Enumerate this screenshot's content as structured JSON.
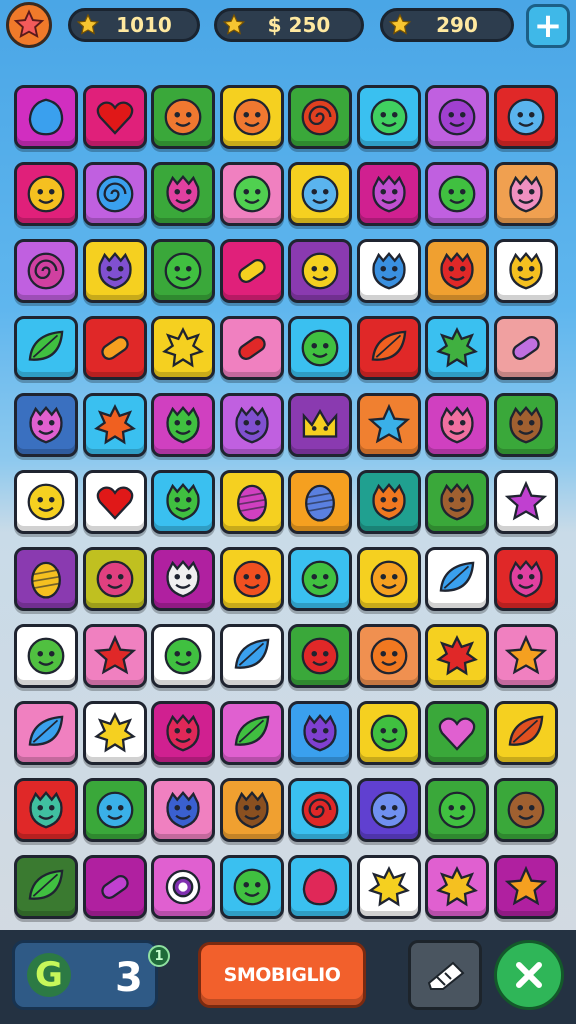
{
  "header": {
    "star_button_icon": "star-icon",
    "counters": [
      {
        "icon": "gold-star-icon",
        "value": "1010"
      },
      {
        "icon": "gold-star-icon",
        "value": "$ 250"
      },
      {
        "icon": "gold-star-icon",
        "value": "290"
      }
    ],
    "add_button_icon": "plus-icon"
  },
  "board": {
    "cols": 8,
    "rows": 12,
    "tiles": [
      [
        {
          "bg": "#d12ec0",
          "icon": "blob",
          "fg": "#3aa0ee"
        },
        {
          "bg": "#e0207a",
          "icon": "heart",
          "fg": "#e01818"
        },
        {
          "bg": "#3aa83a",
          "icon": "face",
          "fg": "#f07830"
        },
        {
          "bg": "#f5d020",
          "icon": "face",
          "fg": "#f07830"
        },
        {
          "bg": "#3aa83a",
          "icon": "swirl",
          "fg": "#e04020"
        },
        {
          "bg": "#3ac0f0",
          "icon": "face",
          "fg": "#40d060"
        },
        {
          "bg": "#c060e0",
          "icon": "face",
          "fg": "#a040d0"
        },
        {
          "bg": "#e02828",
          "icon": "face",
          "fg": "#5ab4ee"
        }
      ],
      [
        {
          "bg": "#e0207a",
          "icon": "face",
          "fg": "#f5c020"
        },
        {
          "bg": "#c060e0",
          "icon": "swirl",
          "fg": "#3aa0ee"
        },
        {
          "bg": "#3aa83a",
          "icon": "monster",
          "fg": "#e040a0"
        },
        {
          "bg": "#f080c0",
          "icon": "face",
          "fg": "#50d050"
        },
        {
          "bg": "#f5d020",
          "icon": "face",
          "fg": "#5ab4ee"
        },
        {
          "bg": "#d02090",
          "icon": "monster",
          "fg": "#c050d0"
        },
        {
          "bg": "#c060e0",
          "icon": "face",
          "fg": "#40c040"
        },
        {
          "bg": "#f0a050",
          "icon": "monster",
          "fg": "#f090c0"
        }
      ],
      [
        {
          "bg": "#c060e0",
          "icon": "swirl",
          "fg": "#d040a0"
        },
        {
          "bg": "#f5d020",
          "icon": "monster",
          "fg": "#8050d0"
        },
        {
          "bg": "#3aa83a",
          "icon": "face",
          "fg": "#40c040"
        },
        {
          "bg": "#e0207a",
          "icon": "candy",
          "fg": "#f5d020"
        },
        {
          "bg": "#8a3ab0",
          "icon": "face",
          "fg": "#f5d020"
        },
        {
          "bg": "#ffffff",
          "icon": "monster",
          "fg": "#3a90e0"
        },
        {
          "bg": "#f0a030",
          "icon": "monster",
          "fg": "#e02828"
        },
        {
          "bg": "#ffffff",
          "icon": "monster",
          "fg": "#f5c020"
        }
      ],
      [
        {
          "bg": "#3ac0f0",
          "icon": "leaf",
          "fg": "#40c040"
        },
        {
          "bg": "#e02828",
          "icon": "candy",
          "fg": "#f5a020"
        },
        {
          "bg": "#f5d020",
          "icon": "splat",
          "fg": "#f5d020"
        },
        {
          "bg": "#f080c0",
          "icon": "candy",
          "fg": "#e02828"
        },
        {
          "bg": "#3ac0f0",
          "icon": "face",
          "fg": "#40c040"
        },
        {
          "bg": "#e02828",
          "icon": "leaf",
          "fg": "#f06020"
        },
        {
          "bg": "#3ac0f0",
          "icon": "splat",
          "fg": "#40b040"
        },
        {
          "bg": "#f0a0a0",
          "icon": "candy",
          "fg": "#c070e0"
        }
      ],
      [
        {
          "bg": "#3a70c0",
          "icon": "monster",
          "fg": "#e060d0"
        },
        {
          "bg": "#3ac0f0",
          "icon": "splat",
          "fg": "#f06020"
        },
        {
          "bg": "#d040c0",
          "icon": "monster",
          "fg": "#40c040"
        },
        {
          "bg": "#c060e0",
          "icon": "monster",
          "fg": "#8050d0"
        },
        {
          "bg": "#8a3ab0",
          "icon": "crown",
          "fg": "#f5d020"
        },
        {
          "bg": "#f08030",
          "icon": "star",
          "fg": "#3ab0e8"
        },
        {
          "bg": "#d040c0",
          "icon": "monster",
          "fg": "#f070a0"
        },
        {
          "bg": "#3aa83a",
          "icon": "monster",
          "fg": "#a06030"
        }
      ],
      [
        {
          "bg": "#ffffff",
          "icon": "face",
          "fg": "#f5d020"
        },
        {
          "bg": "#ffffff",
          "icon": "heart",
          "fg": "#e01818"
        },
        {
          "bg": "#3ac0f0",
          "icon": "monster",
          "fg": "#40c040"
        },
        {
          "bg": "#f5d020",
          "icon": "egg",
          "fg": "#d040c0"
        },
        {
          "bg": "#f5a020",
          "icon": "egg",
          "fg": "#5a80e0"
        },
        {
          "bg": "#20a090",
          "icon": "monster",
          "fg": "#f07820"
        },
        {
          "bg": "#3aa83a",
          "icon": "monster",
          "fg": "#a06030"
        },
        {
          "bg": "#ffffff",
          "icon": "star",
          "fg": "#c040d0"
        }
      ],
      [
        {
          "bg": "#8a3ab0",
          "icon": "egg",
          "fg": "#f5c020"
        },
        {
          "bg": "#c0c020",
          "icon": "face",
          "fg": "#e04080"
        },
        {
          "bg": "#b020a0",
          "icon": "monster",
          "fg": "#f0f0f0"
        },
        {
          "bg": "#f5d020",
          "icon": "face",
          "fg": "#f05020"
        },
        {
          "bg": "#3ac0f0",
          "icon": "face",
          "fg": "#40c040"
        },
        {
          "bg": "#f5d020",
          "icon": "face",
          "fg": "#f5a020"
        },
        {
          "bg": "#ffffff",
          "icon": "leaf",
          "fg": "#3aa0ee"
        },
        {
          "bg": "#e02828",
          "icon": "monster",
          "fg": "#e040a0"
        }
      ],
      [
        {
          "bg": "#ffffff",
          "icon": "face",
          "fg": "#50c040"
        },
        {
          "bg": "#f080c0",
          "icon": "star",
          "fg": "#e02828"
        },
        {
          "bg": "#ffffff",
          "icon": "face",
          "fg": "#40c040"
        },
        {
          "bg": "#ffffff",
          "icon": "leaf",
          "fg": "#3aa0ee"
        },
        {
          "bg": "#3aa83a",
          "icon": "face",
          "fg": "#e02828"
        },
        {
          "bg": "#f09050",
          "icon": "face",
          "fg": "#f07820"
        },
        {
          "bg": "#f5d020",
          "icon": "splat",
          "fg": "#e02828"
        },
        {
          "bg": "#f080c0",
          "icon": "star",
          "fg": "#f5a020"
        }
      ],
      [
        {
          "bg": "#f080c0",
          "icon": "leaf",
          "fg": "#3aa0ee"
        },
        {
          "bg": "#ffffff",
          "icon": "splat",
          "fg": "#f5d020"
        },
        {
          "bg": "#d02090",
          "icon": "monster",
          "fg": "#e02858"
        },
        {
          "bg": "#e060d0",
          "icon": "leaf",
          "fg": "#40c040"
        },
        {
          "bg": "#3aa0ee",
          "icon": "monster",
          "fg": "#8040d0"
        },
        {
          "bg": "#f5d020",
          "icon": "face",
          "fg": "#40c040"
        },
        {
          "bg": "#3aa83a",
          "icon": "heart",
          "fg": "#e060d0"
        },
        {
          "bg": "#f5d020",
          "icon": "leaf",
          "fg": "#e05020"
        }
      ],
      [
        {
          "bg": "#e02828",
          "icon": "monster",
          "fg": "#40c0a0"
        },
        {
          "bg": "#3aa83a",
          "icon": "face",
          "fg": "#3ab0e8"
        },
        {
          "bg": "#f080c0",
          "icon": "monster",
          "fg": "#3a60d0"
        },
        {
          "bg": "#f0a030",
          "icon": "monster",
          "fg": "#8a5020"
        },
        {
          "bg": "#3ac0f0",
          "icon": "swirl",
          "fg": "#e02828"
        },
        {
          "bg": "#6040d0",
          "icon": "face",
          "fg": "#7090f0"
        },
        {
          "bg": "#3aa83a",
          "icon": "face",
          "fg": "#40c040"
        },
        {
          "bg": "#3aa83a",
          "icon": "face",
          "fg": "#a06030"
        }
      ],
      [
        {
          "bg": "#3a7a30",
          "icon": "leaf",
          "fg": "#40c040"
        },
        {
          "bg": "#b020a0",
          "icon": "candy",
          "fg": "#c040d0"
        },
        {
          "bg": "#e060d0",
          "icon": "ring",
          "fg": "#8030b0"
        },
        {
          "bg": "#3ac0f0",
          "icon": "face",
          "fg": "#40c040"
        },
        {
          "bg": "#3ac0f0",
          "icon": "blob",
          "fg": "#e02858"
        },
        {
          "bg": "#ffffff",
          "icon": "splat",
          "fg": "#f5d020"
        },
        {
          "bg": "#e060d0",
          "icon": "splat",
          "fg": "#f5c020"
        },
        {
          "bg": "#b020a0",
          "icon": "star",
          "fg": "#f5a020"
        }
      ]
    ]
  },
  "footer": {
    "moves_icon_letter": "G",
    "moves_count": "3",
    "moves_badge": "1",
    "action_button_label": "SMOBIGLIO",
    "tool_button_icon": "eraser-icon",
    "close_button_icon": "close-icon"
  },
  "colors": {
    "accent_orange": "#f2602c",
    "accent_green": "#2fb658",
    "accent_blue": "#3fb8e8"
  }
}
